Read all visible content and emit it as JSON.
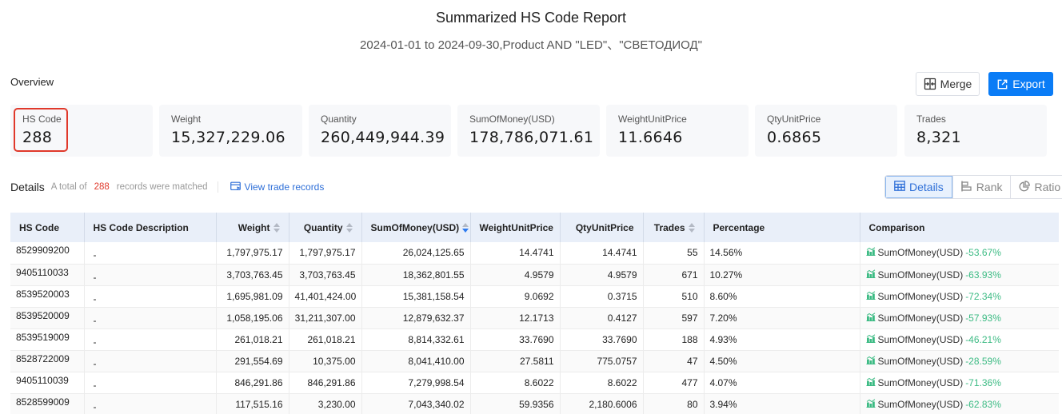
{
  "header": {
    "title": "Summarized HS Code Report",
    "subtitle": "2024-01-01 to 2024-09-30,Product AND \"LED\"、\"СВЕТОДИОД\""
  },
  "overview": {
    "label": "Overview",
    "merge_label": "Merge",
    "export_label": "Export",
    "stats": [
      {
        "label": "HS Code",
        "value": "288"
      },
      {
        "label": "Weight",
        "value": "15,327,229.06"
      },
      {
        "label": "Quantity",
        "value": "260,449,944.39"
      },
      {
        "label": "SumOfMoney(USD)",
        "value": "178,786,071.61"
      },
      {
        "label": "WeightUnitPrice",
        "value": "11.6646"
      },
      {
        "label": "QtyUnitPrice",
        "value": "0.6865"
      },
      {
        "label": "Trades",
        "value": "8,321"
      }
    ],
    "highlight_color": "#e0392b",
    "accent_color": "#0a7cf6"
  },
  "details": {
    "title": "Details",
    "meta_prefix": "A total of",
    "count": "288",
    "meta_suffix": "records were matched",
    "view_link": "View trade records",
    "view_toggle": [
      {
        "label": "Details",
        "icon": "table-icon",
        "active": true
      },
      {
        "label": "Rank",
        "icon": "rank-bars-icon",
        "active": false
      },
      {
        "label": "Ratio",
        "icon": "pie-chart-icon",
        "active": false
      }
    ]
  },
  "table": {
    "columns": [
      {
        "label": "HS Code",
        "sortable": false
      },
      {
        "label": "HS Code Description",
        "sortable": false
      },
      {
        "label": "Weight",
        "sortable": true
      },
      {
        "label": "Quantity",
        "sortable": true
      },
      {
        "label": "SumOfMoney(USD)",
        "sortable": true,
        "sorted": "desc"
      },
      {
        "label": "WeightUnitPrice",
        "sortable": false
      },
      {
        "label": "QtyUnitPrice",
        "sortable": false
      },
      {
        "label": "Trades",
        "sortable": true
      },
      {
        "label": "Percentage",
        "sortable": false
      },
      {
        "label": "Comparison",
        "sortable": false
      }
    ],
    "rows": [
      {
        "code": "8529909200",
        "desc": "-",
        "weight": "1,797,975.17",
        "quantity": "1,797,975.17",
        "sum": "26,024,125.65",
        "wup": "14.4741",
        "qup": "14.4741",
        "trades": "55",
        "pct": "14.56%",
        "cmp_label": "SumOfMoney(USD)",
        "cmp_value": "-53.67%"
      },
      {
        "code": "9405110033",
        "desc": "-",
        "weight": "3,703,763.45",
        "quantity": "3,703,763.45",
        "sum": "18,362,801.55",
        "wup": "4.9579",
        "qup": "4.9579",
        "trades": "671",
        "pct": "10.27%",
        "cmp_label": "SumOfMoney(USD)",
        "cmp_value": "-63.93%"
      },
      {
        "code": "8539520003",
        "desc": "-",
        "weight": "1,695,981.09",
        "quantity": "41,401,424.00",
        "sum": "15,381,158.54",
        "wup": "9.0692",
        "qup": "0.3715",
        "trades": "510",
        "pct": "8.60%",
        "cmp_label": "SumOfMoney(USD)",
        "cmp_value": "-72.34%"
      },
      {
        "code": "8539520009",
        "desc": "-",
        "weight": "1,058,195.06",
        "quantity": "31,211,307.00",
        "sum": "12,879,632.37",
        "wup": "12.1713",
        "qup": "0.4127",
        "trades": "597",
        "pct": "7.20%",
        "cmp_label": "SumOfMoney(USD)",
        "cmp_value": "-57.93%"
      },
      {
        "code": "8539519009",
        "desc": "-",
        "weight": "261,018.21",
        "quantity": "261,018.21",
        "sum": "8,814,332.61",
        "wup": "33.7690",
        "qup": "33.7690",
        "trades": "188",
        "pct": "4.93%",
        "cmp_label": "SumOfMoney(USD)",
        "cmp_value": "-46.21%"
      },
      {
        "code": "8528722009",
        "desc": "-",
        "weight": "291,554.69",
        "quantity": "10,375.00",
        "sum": "8,041,410.00",
        "wup": "27.5811",
        "qup": "775.0757",
        "trades": "47",
        "pct": "4.50%",
        "cmp_label": "SumOfMoney(USD)",
        "cmp_value": "-28.59%"
      },
      {
        "code": "9405110039",
        "desc": "-",
        "weight": "846,291.86",
        "quantity": "846,291.86",
        "sum": "7,279,998.54",
        "wup": "8.6022",
        "qup": "8.6022",
        "trades": "477",
        "pct": "4.07%",
        "cmp_label": "SumOfMoney(USD)",
        "cmp_value": "-71.36%"
      },
      {
        "code": "8528599009",
        "desc": "-",
        "weight": "117,515.16",
        "quantity": "3,230.00",
        "sum": "7,043,340.02",
        "wup": "59.9356",
        "qup": "2,180.6006",
        "trades": "80",
        "pct": "3.94%",
        "cmp_label": "SumOfMoney(USD)",
        "cmp_value": "-62.83%"
      }
    ],
    "comparison_icon": "bar-chart-icon",
    "comparison_color": "#3dbb84"
  }
}
